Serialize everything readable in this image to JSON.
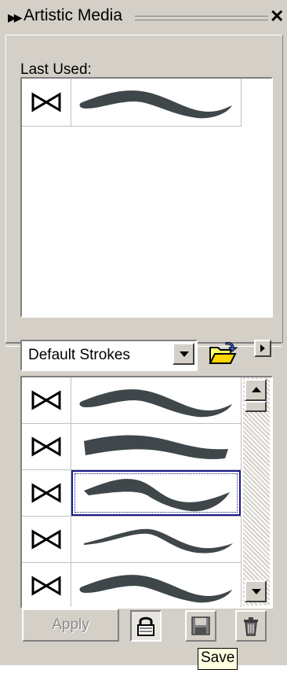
{
  "window": {
    "title": "Artistic Media",
    "close_icon": "close-icon",
    "title_chevron_icon": "double-chevron-right-icon"
  },
  "last_used": {
    "label": "Last Used:",
    "items": [
      {
        "icon": "bowtie-icon",
        "stroke": "stroke-preview-1"
      }
    ]
  },
  "stroke_set": {
    "selected": "Default Strokes",
    "open_icon": "folder-open-icon",
    "flyout_icon": "flyout-arrow-icon"
  },
  "strokes": [
    {
      "icon": "bowtie-icon",
      "stroke": "stroke-preview-1",
      "selected": false
    },
    {
      "icon": "bowtie-icon",
      "stroke": "stroke-preview-2",
      "selected": false
    },
    {
      "icon": "bowtie-icon",
      "stroke": "stroke-preview-3",
      "selected": true
    },
    {
      "icon": "bowtie-icon",
      "stroke": "stroke-preview-4",
      "selected": false
    },
    {
      "icon": "bowtie-icon",
      "stroke": "stroke-preview-5",
      "selected": false
    }
  ],
  "buttons": {
    "apply": "Apply",
    "lock_icon": "lock-icon",
    "save_icon": "floppy-disk-icon",
    "delete_icon": "trash-icon"
  },
  "tooltip": {
    "text": "Save"
  },
  "colors": {
    "panel_bg": "#d4d0c8",
    "stroke_fill": "#3f474a",
    "selection_border": "#1a1a8a",
    "tooltip_bg": "#ffffe1"
  }
}
